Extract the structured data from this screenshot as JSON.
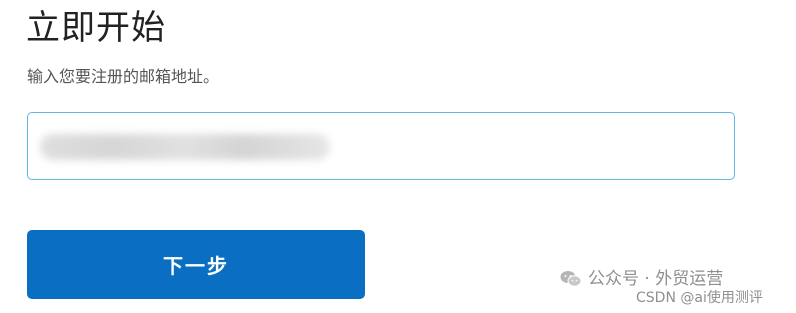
{
  "header": {
    "title": "立即开始",
    "subtitle": "输入您要注册的邮箱地址。"
  },
  "form": {
    "email_value": "",
    "email_placeholder": "",
    "next_label": "下一步"
  },
  "watermark": {
    "account": "公众号 · 外贸运营",
    "source": "CSDN @ai使用测评"
  },
  "colors": {
    "primary_button": "#0a6fc2",
    "input_border": "#5fb8e6",
    "title_text": "#222222"
  },
  "icons": {
    "watermark_icon": "wechat-icon"
  }
}
